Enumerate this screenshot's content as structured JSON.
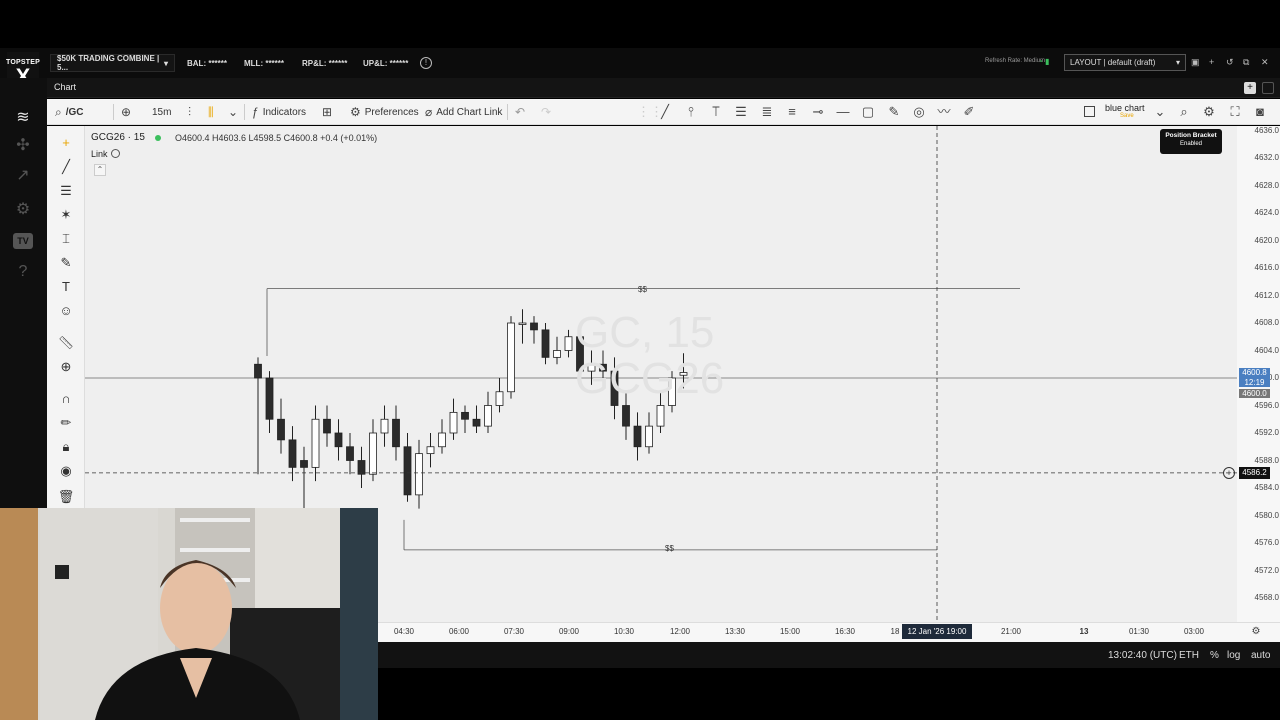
{
  "header": {
    "brand": "TOPSTEP",
    "brand_mark": "X",
    "account": "$50K TRADING COMBINE | 5...",
    "metrics": [
      "BAL: ******",
      "MLL: ******",
      "RP&L: ******",
      "UP&L: ******"
    ],
    "refresh_rate": "Refresh Rate: Medium",
    "layout": "LAYOUT | default (draft)"
  },
  "chart_tab": {
    "label": "Chart"
  },
  "toolbar": {
    "symbol": "/GC",
    "interval": "15m",
    "indicators": "Indicators",
    "preferences": "Preferences",
    "add_chart_link": "Add Chart Link",
    "layout_name": "blue chart",
    "layout_save": "Save"
  },
  "legend": {
    "symbol": "GCG26 · 15",
    "ohlc": "O4600.4  H4603.6  L4598.5  C4600.8  +0.4 (+0.01%)",
    "link": "Link"
  },
  "watermark": {
    "line1": "GC, 15",
    "line2": "GCG26"
  },
  "position_bracket": {
    "title": "Position Bracket",
    "status": "Enabled"
  },
  "price_axis": {
    "labels": [
      "4636.0",
      "4632.0",
      "4628.0",
      "4624.0",
      "4620.0",
      "4616.0",
      "4612.0",
      "4608.0",
      "4604.0",
      "4600.0",
      "4596.0",
      "4592.0",
      "4588.0",
      "4584.0",
      "4580.0",
      "4576.0",
      "4572.0",
      "4568.0"
    ],
    "last_price": "4600.8",
    "countdown": "12:19",
    "level_price": "4600.0",
    "crosshair_price": "4586.2"
  },
  "time_axis": {
    "labels": [
      "04:30",
      "06:00",
      "07:30",
      "09:00",
      "10:30",
      "12:00",
      "13:30",
      "15:00",
      "16:30",
      "18",
      "21:00",
      "13",
      "01:30",
      "03:00"
    ],
    "crosshair_time": "12 Jan '26  19:00"
  },
  "status_bar": {
    "clock": "13:02:40 (UTC)",
    "session": "ETH",
    "percent": "%",
    "log": "log",
    "auto": "auto"
  },
  "annotations": {
    "upper_label": "$$",
    "lower_label": "$$"
  },
  "colors": {
    "up_candle": "#ffffff",
    "down_candle": "#2b2b2b",
    "accent": "#3bbf5d",
    "save": "#e8a500"
  },
  "chart_data": {
    "type": "candlestick",
    "symbol": "GCG26",
    "interval": "15",
    "ylim": [
      4566,
      4637
    ],
    "x": [
      "03:30",
      "03:45",
      "04:00",
      "04:15",
      "04:30",
      "04:45",
      "05:00",
      "05:15",
      "05:30",
      "05:45",
      "06:00",
      "06:15",
      "06:30",
      "06:45",
      "07:00",
      "07:15",
      "07:30",
      "07:45",
      "08:00",
      "08:15",
      "08:30",
      "08:45",
      "09:00",
      "09:15",
      "09:30",
      "09:45",
      "10:00",
      "10:15",
      "10:30",
      "10:45",
      "11:00",
      "11:15",
      "11:30",
      "11:45",
      "12:00",
      "12:15",
      "12:30",
      "12:45"
    ],
    "open": [
      4602,
      4600,
      4594,
      4591,
      4588,
      4587,
      4594,
      4592,
      4590,
      4588,
      4586,
      4592,
      4594,
      4590,
      4583,
      4589,
      4590,
      4592,
      4595,
      4594,
      4593,
      4596,
      4598,
      4608,
      4608,
      4607,
      4603,
      4604,
      4606,
      4601,
      4602,
      4601,
      4596,
      4593,
      4590,
      4593,
      4596,
      4600.4
    ],
    "close": [
      4600,
      4594,
      4591,
      4587,
      4587,
      4594,
      4592,
      4590,
      4588,
      4586,
      4592,
      4594,
      4590,
      4583,
      4589,
      4590,
      4592,
      4595,
      4594,
      4593,
      4596,
      4598,
      4608,
      4608,
      4607,
      4603,
      4604,
      4606,
      4601,
      4602,
      4601,
      4596,
      4593,
      4590,
      4593,
      4596,
      4600,
      4600.8
    ],
    "high": [
      4603,
      4601,
      4597,
      4593,
      4590,
      4596,
      4596,
      4594,
      4592,
      4590,
      4594,
      4596,
      4596,
      4592,
      4591,
      4592,
      4594,
      4597,
      4596,
      4596,
      4598,
      4600,
      4609,
      4610,
      4609,
      4608,
      4606,
      4607,
      4607,
      4604,
      4604,
      4603,
      4598,
      4595,
      4595,
      4598,
      4601,
      4603.6
    ],
    "low": [
      4586,
      4592,
      4589,
      4585,
      4578,
      4585,
      4590,
      4588,
      4586,
      4584,
      4585,
      4590,
      4588,
      4582,
      4581,
      4587,
      4589,
      4591,
      4592,
      4592,
      4592,
      4595,
      4597,
      4605,
      4605,
      4602,
      4602,
      4603,
      4599,
      4599,
      4600,
      4594,
      4591,
      4588,
      4589,
      4592,
      4595,
      4598.5
    ],
    "levels": [
      {
        "price": 4600.0,
        "label": ""
      },
      {
        "price": 4613.0,
        "label": "$$"
      },
      {
        "price": 4575.0,
        "label": "$$"
      }
    ],
    "crosshair": {
      "price": 4586.2,
      "time": "12 Jan '26 19:00"
    }
  }
}
